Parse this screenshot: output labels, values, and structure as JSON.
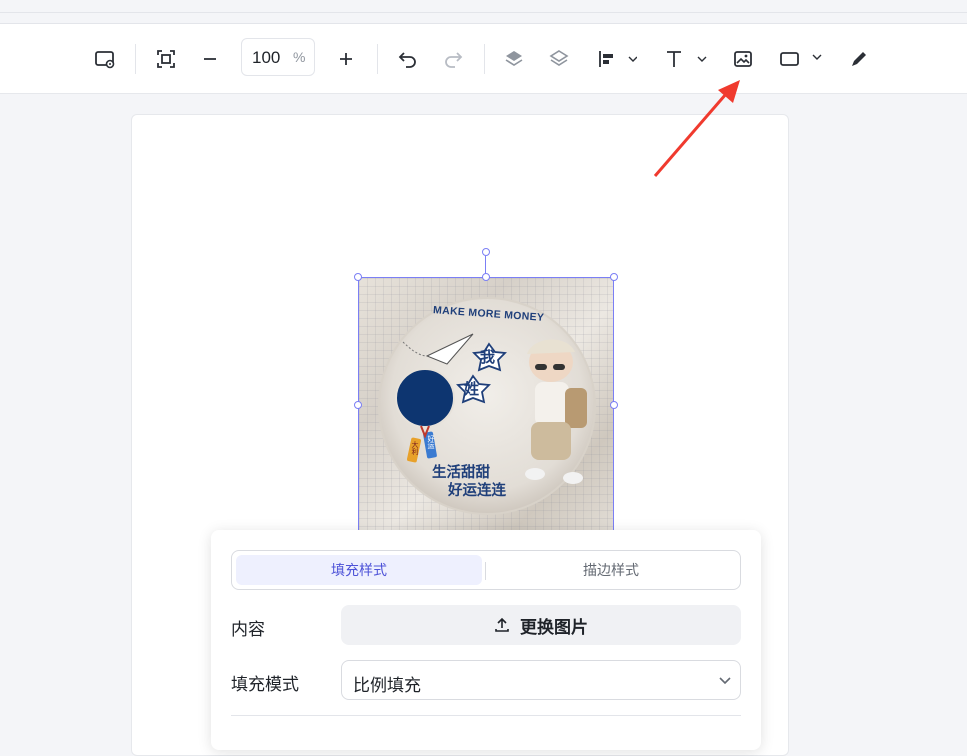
{
  "toolbar": {
    "zoom_value": "100",
    "zoom_unit": "%",
    "icons": [
      "canvas-settings-icon",
      "fit-screen-icon",
      "zoom-out-icon",
      "zoom-in-icon",
      "undo-icon",
      "redo-icon",
      "bring-forward-icon",
      "send-backward-icon",
      "align-icon",
      "text-icon",
      "image-icon",
      "shape-icon",
      "pen-icon"
    ]
  },
  "artwork": {
    "banner_text": "MAKE MORE MONEY",
    "char_1": "我",
    "char_2": "姓",
    "line_1": "生活甜甜",
    "line_2": "好运连连",
    "tag_1": "大利",
    "tag_2": "好运"
  },
  "panel": {
    "tabs": {
      "fill_style": "填充样式",
      "stroke_style": "描边样式"
    },
    "content_label": "内容",
    "replace_image_label": "更换图片",
    "fill_mode_label": "填充模式",
    "fill_mode_value": "比例填充"
  },
  "colors": {
    "accent": "#4e53d8",
    "selection": "#7b7ff5",
    "arrow": "#f03a2e",
    "navy": "#0d3570"
  }
}
